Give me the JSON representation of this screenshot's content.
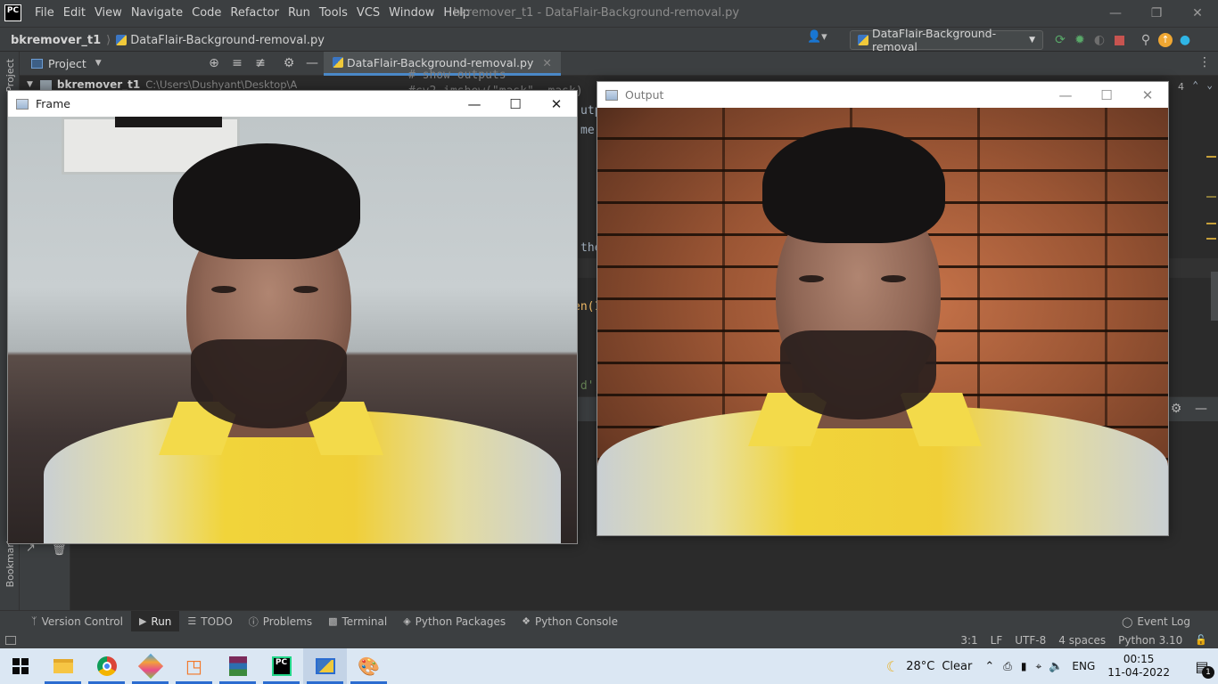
{
  "app": {
    "logo": "PC",
    "menu": [
      "File",
      "Edit",
      "View",
      "Navigate",
      "Code",
      "Refactor",
      "Run",
      "Tools",
      "VCS",
      "Window",
      "Help"
    ],
    "window_title": "bkremover_t1 - DataFlair-Background-removal.py"
  },
  "navbar": {
    "project": "bkremover_t1",
    "file": "DataFlair-Background-removal.py",
    "run_config": "DataFlair-Background-removal"
  },
  "project_panel": {
    "title": "Project",
    "root_name": "bkremover_t1",
    "root_path": "C:\\Users\\Dushyant\\Desktop\\AI\\bkremov",
    "side_label": "Project",
    "bookmarks_label": "Bookmarks"
  },
  "editor": {
    "tab": "DataFlair-Background-removal.py",
    "visible_fragments": [
      "# show outputs",
      "#cv2.imshow(\"mask\", mask)",
      "utpu",
      "me)",
      "the",
      "en(1",
      "'d')",
      ":/"
    ],
    "line_count_label": "4"
  },
  "windows": {
    "frame_title": "Frame",
    "output_title": "Output"
  },
  "tool_buttons": [
    {
      "icon": "version-control-icon",
      "label": "Version Control",
      "active": false
    },
    {
      "icon": "run-icon",
      "label": "Run",
      "active": true
    },
    {
      "icon": "todo-icon",
      "label": "TODO",
      "active": false
    },
    {
      "icon": "problems-icon",
      "label": "Problems",
      "active": false
    },
    {
      "icon": "terminal-icon",
      "label": "Terminal",
      "active": false
    },
    {
      "icon": "python-packages-icon",
      "label": "Python Packages",
      "active": false
    },
    {
      "icon": "python-console-icon",
      "label": "Python Console",
      "active": false
    }
  ],
  "event_log": "Event Log",
  "status": {
    "position": "3:1",
    "line_sep": "LF",
    "encoding": "UTF-8",
    "indent": "4 spaces",
    "interpreter": "Python 3.10"
  },
  "taskbar": {
    "weather_temp": "28°C",
    "weather_text": "Clear",
    "lang": "ENG",
    "time": "00:15",
    "date": "11-04-2022",
    "notifications": "1"
  },
  "colors": {
    "ide_bg": "#2b2b2b",
    "ide_panel": "#3c3f41",
    "accent": "#4a88c7",
    "taskbar": "#dbe7f3"
  }
}
